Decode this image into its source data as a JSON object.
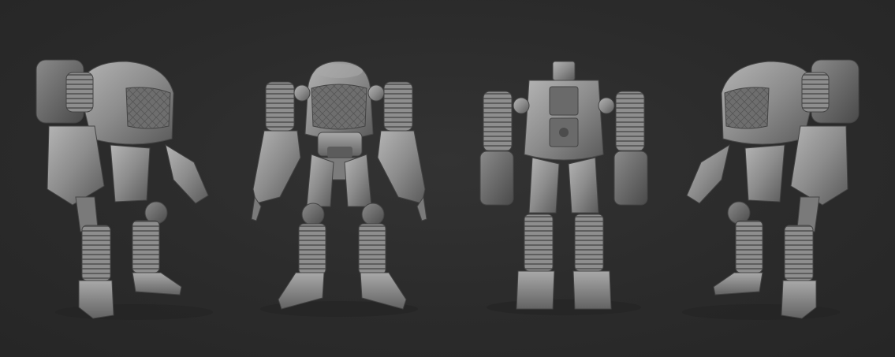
{
  "scene": {
    "background_color": "#2b2b2b",
    "model_color": "#8a8a8a",
    "views": [
      {
        "name": "left-three-quarter-view"
      },
      {
        "name": "front-view"
      },
      {
        "name": "back-view"
      },
      {
        "name": "right-three-quarter-view"
      }
    ]
  }
}
